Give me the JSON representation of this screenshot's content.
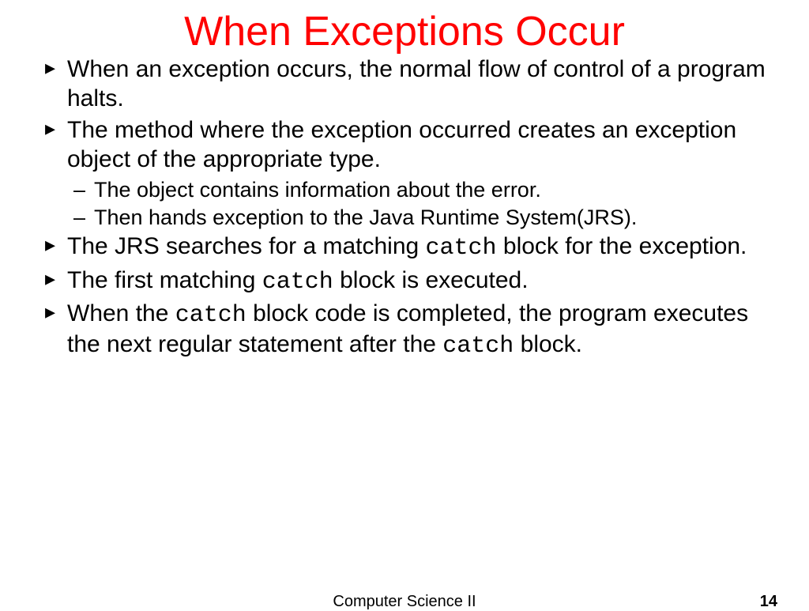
{
  "title": "When Exceptions Occur",
  "bullets": {
    "b1": "When an exception occurs, the normal flow of control of a program halts.",
    "b2": "The method where the exception occurred creates an exception object of the appropriate type.",
    "s1": "The object contains information about the error.",
    "s2": "Then hands exception to the Java Runtime System(JRS).",
    "b3a": "The JRS searches for a matching ",
    "b3b": " block for the exception.",
    "b4a": "The first matching ",
    "b4b": " block is executed.",
    "b5a": "When the ",
    "b5b": " block code is completed, the program executes the next regular statement after the ",
    "b5c": " block.",
    "code": "catch"
  },
  "footer": {
    "center": "Computer Science II",
    "page": "14"
  }
}
